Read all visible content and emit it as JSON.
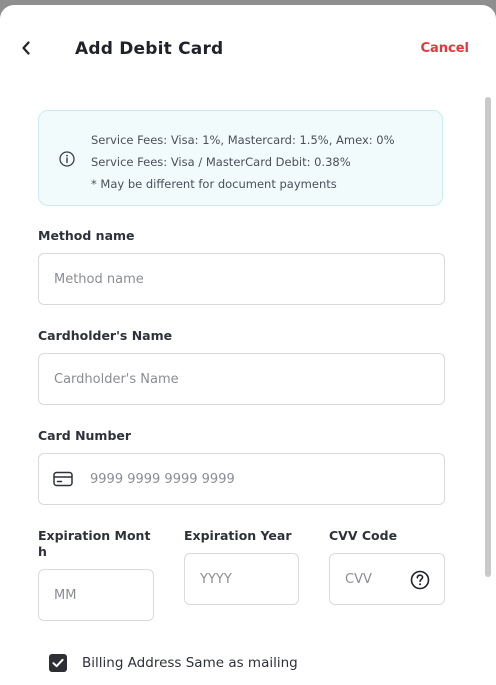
{
  "header": {
    "title": "Add Debit Card",
    "cancel_label": "Cancel"
  },
  "info": {
    "line1": "Service Fees: Visa: 1%, Mastercard: 1.5%, Amex: 0%",
    "line2": "Service Fees: Visa / MasterCard Debit: 0.38%",
    "line3": "* May be different for document payments"
  },
  "form": {
    "method_name": {
      "label": "Method name",
      "placeholder": "Method name",
      "value": ""
    },
    "cardholder": {
      "label": "Cardholder's Name",
      "placeholder": "Cardholder's Name",
      "value": ""
    },
    "card_number": {
      "label": "Card Number",
      "placeholder": "9999 9999 9999 9999",
      "value": ""
    },
    "exp_month": {
      "label_line1": "Expiration Mont",
      "label_line2": "h",
      "placeholder": "MM",
      "value": ""
    },
    "exp_year": {
      "label": "Expiration Year",
      "placeholder": "YYYY",
      "value": ""
    },
    "cvv": {
      "label": "CVV Code",
      "placeholder": "CVV",
      "value": ""
    },
    "billing_same": {
      "label": "Billing Address Same as mailing",
      "checked": true
    }
  },
  "colors": {
    "accent_red": "#e8353b",
    "info_bg": "#f1fbfc",
    "info_border": "#c8ecef"
  },
  "icons": [
    "back-chevron-icon",
    "info-icon",
    "credit-card-icon",
    "help-question-icon",
    "checkmark-icon"
  ]
}
